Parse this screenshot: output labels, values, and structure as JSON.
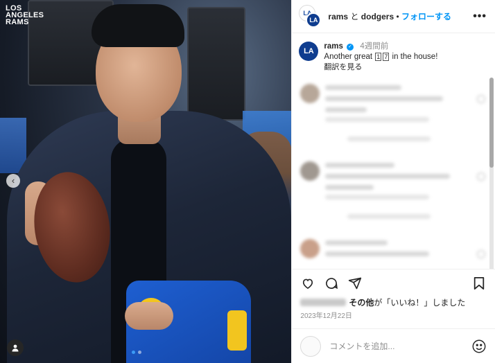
{
  "photo": {
    "team_logo_lines": [
      "LOS",
      "ANGELES",
      "RAMS"
    ]
  },
  "header": {
    "account1": "rams",
    "connector": "と",
    "account2": "dodgers",
    "separator": "•",
    "follow_label": "フォローする",
    "more_label": "•••",
    "avatar1_text": "LA",
    "avatar2_text": "LA"
  },
  "caption": {
    "avatar_text": "LA",
    "username": "rams",
    "time": "4週間前",
    "text_before": "Another great",
    "number_digits": [
      "1",
      "7"
    ],
    "text_after": "in the house!",
    "translate_label": "翻訳を見る"
  },
  "likes": {
    "suffix_bold": "その他",
    "text": "が「いいね！」しました"
  },
  "post_date": "2023年12月22日",
  "comment_box": {
    "placeholder": "コメントを追加..."
  },
  "icons": {
    "like": "heart-icon",
    "comment": "comment-icon",
    "share": "share-icon",
    "save": "bookmark-icon",
    "emoji": "smiley-icon",
    "user_tag": "user-tag-icon",
    "carousel_prev": "chevron-left-icon"
  },
  "colors": {
    "link_blue": "#0095f6",
    "rams_blue": "#0f3d8f",
    "rams_yellow": "#f2c51f"
  }
}
